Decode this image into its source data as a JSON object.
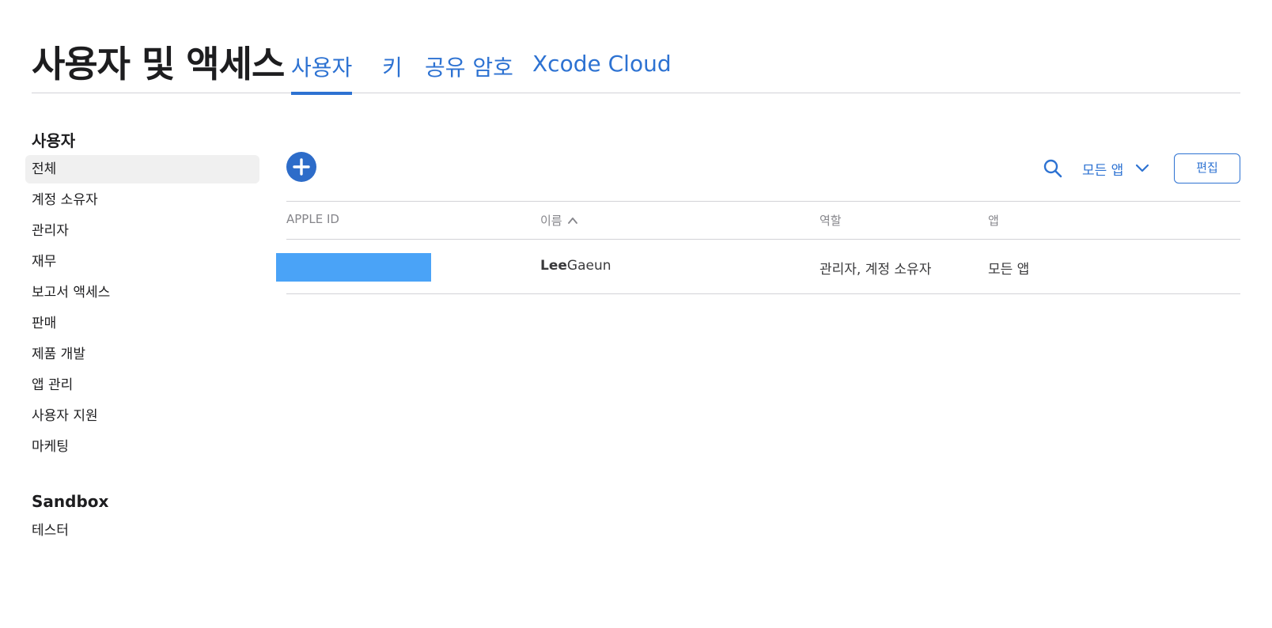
{
  "header": {
    "title": "사용자 및 액세스",
    "tabs": [
      {
        "label": "사용자",
        "active": true
      },
      {
        "label": "키",
        "active": false
      },
      {
        "label": "공유 암호",
        "active": false
      },
      {
        "label": "Xcode Cloud",
        "active": false
      }
    ]
  },
  "sidebar": {
    "users_section": {
      "title": "사용자",
      "items": [
        {
          "label": "전체",
          "selected": true
        },
        {
          "label": "계정 소유자"
        },
        {
          "label": "관리자"
        },
        {
          "label": "재무"
        },
        {
          "label": "보고서 액세스"
        },
        {
          "label": "판매"
        },
        {
          "label": "제품 개발"
        },
        {
          "label": "앱 관리"
        },
        {
          "label": "사용자 지원"
        },
        {
          "label": "마케팅"
        }
      ]
    },
    "sandbox_section": {
      "title": "Sandbox",
      "items": [
        {
          "label": "테스터"
        }
      ]
    }
  },
  "toolbar": {
    "add_icon": "plus-circle-icon",
    "search_icon": "search-icon",
    "app_filter_label": "모든 앱",
    "app_filter_icon": "chevron-down-icon",
    "edit_label": "편집"
  },
  "table": {
    "columns": [
      {
        "label": "APPLE ID"
      },
      {
        "label": "이름",
        "sort": "ascending"
      },
      {
        "label": "역할"
      },
      {
        "label": "앱"
      }
    ],
    "rows": [
      {
        "apple_id": "",
        "last_name": "Lee",
        "first_name": "Gaeun",
        "role": "관리자, 계정 소유자",
        "apps": "모든 앱"
      }
    ]
  },
  "colors": {
    "accent": "#2d72d2",
    "add_button": "#2d6cc9",
    "redaction": "#4aa3f7",
    "selected_bg": "#f0f0f0",
    "rule": "#d2d2d7",
    "muted_text": "#86868b"
  }
}
